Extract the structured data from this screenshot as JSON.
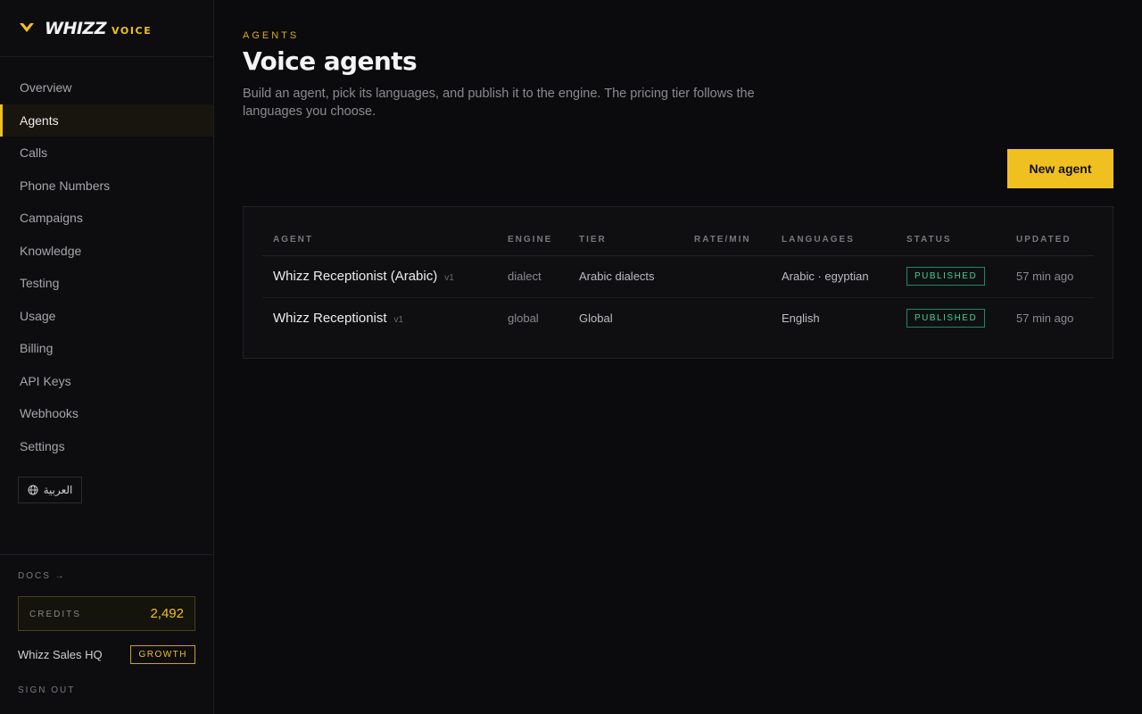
{
  "brand": {
    "name": "WHIZZ",
    "sub": "VOICE",
    "accent": "#f0c020"
  },
  "sidebar": {
    "items": [
      {
        "label": "Overview",
        "active": false
      },
      {
        "label": "Agents",
        "active": true
      },
      {
        "label": "Calls",
        "active": false
      },
      {
        "label": "Phone Numbers",
        "active": false
      },
      {
        "label": "Campaigns",
        "active": false
      },
      {
        "label": "Knowledge",
        "active": false
      },
      {
        "label": "Testing",
        "active": false
      },
      {
        "label": "Usage",
        "active": false
      },
      {
        "label": "Billing",
        "active": false
      },
      {
        "label": "API Keys",
        "active": false
      },
      {
        "label": "Webhooks",
        "active": false
      },
      {
        "label": "Settings",
        "active": false
      }
    ],
    "language_toggle": {
      "label": "العربية",
      "icon": "globe-icon"
    },
    "docs_label": "DOCS →",
    "credits": {
      "label": "CREDITS",
      "value": "2,492"
    },
    "org": {
      "name": "Whizz Sales HQ",
      "plan": "GROWTH"
    },
    "signout_label": "SIGN OUT"
  },
  "main": {
    "eyebrow": "AGENTS",
    "title": "Voice agents",
    "subtitle": "Build an agent, pick its languages, and publish it to the engine. The pricing tier follows the languages you choose.",
    "new_agent_label": "New agent",
    "table": {
      "headers": [
        "AGENT",
        "ENGINE",
        "TIER",
        "RATE/MIN",
        "LANGUAGES",
        "STATUS",
        "UPDATED"
      ],
      "rows": [
        {
          "agent": "Whizz Receptionist (Arabic)",
          "version": "v1",
          "engine": "dialect",
          "tier": "Arabic dialects",
          "rate": "",
          "languages": "Arabic · egyptian",
          "status": "PUBLISHED",
          "updated": "57 min ago"
        },
        {
          "agent": "Whizz Receptionist",
          "version": "v1",
          "engine": "global",
          "tier": "Global",
          "rate": "",
          "languages": "English",
          "status": "PUBLISHED",
          "updated": "57 min ago"
        }
      ]
    }
  }
}
